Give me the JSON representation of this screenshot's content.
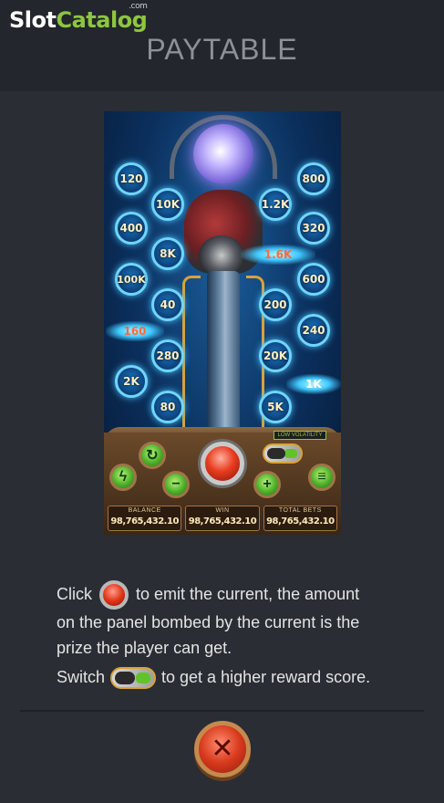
{
  "brand": {
    "logo_slot": "Slot",
    "logo_catalog": "Catalog",
    "logo_com": ".com"
  },
  "header": {
    "title": "PAYTABLE"
  },
  "game_preview": {
    "left_multipliers": [
      "120",
      "10K",
      "400",
      "8K",
      "100K",
      "40",
      "280",
      "2K",
      "80"
    ],
    "right_multipliers": [
      "800",
      "1.2K",
      "320",
      "600",
      "200",
      "240",
      "20K",
      "5K"
    ],
    "flash_multipliers": [
      "1.6K",
      "160",
      "1K"
    ],
    "volatility_label": "LOW VOLATILITY",
    "stats": [
      {
        "label": "BALANCE",
        "value": "98,765,432.10"
      },
      {
        "label": "WIN",
        "value": "98,765,432.10"
      },
      {
        "label": "TOTAL BETS",
        "value": "98,765,432.10"
      }
    ]
  },
  "instructions": {
    "line1_prefix": "Click",
    "line1_suffix": "to emit the current, the amount",
    "line2": "on the panel bombed by the current  is the",
    "line3": "prize the player can get.",
    "line4_prefix": "Switch",
    "line4_suffix": "to get a higher reward score."
  },
  "icons": {
    "emit_button": "red-emit-button-icon",
    "switch": "volatility-switch-icon",
    "close": "close-icon"
  }
}
